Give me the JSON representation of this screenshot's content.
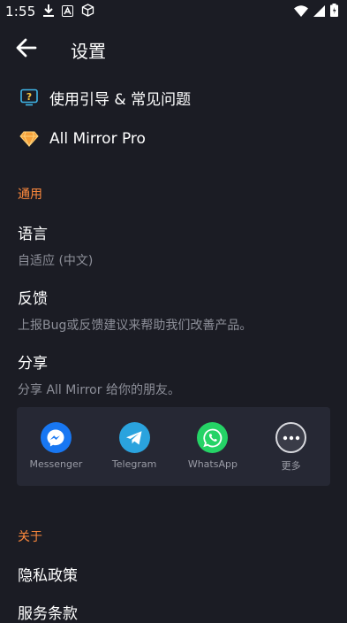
{
  "status_bar": {
    "time": "1:55"
  },
  "app_bar": {
    "title": "设置"
  },
  "top_items": [
    {
      "label": "使用引导 & 常见问题",
      "icon": "help-icon"
    },
    {
      "label": "All Mirror Pro",
      "icon": "diamond-icon"
    }
  ],
  "sections": {
    "general": "通用",
    "about": "关于"
  },
  "prefs": {
    "language": {
      "title": "语言",
      "summary": "自适应 (中文)"
    },
    "feedback": {
      "title": "反馈",
      "summary": "上报Bug或反馈建议来帮助我们改善产品。"
    },
    "share": {
      "title": "分享",
      "summary": "分享 All Mirror 给你的朋友。"
    }
  },
  "share_apps": [
    {
      "name": "Messenger",
      "icon": "messenger-icon",
      "color": "#1877f2"
    },
    {
      "name": "Telegram",
      "icon": "telegram-icon",
      "color": "#2aa3de"
    },
    {
      "name": "WhatsApp",
      "icon": "whatsapp-icon",
      "color": "#25d366"
    },
    {
      "name": "更多",
      "icon": "more-icon",
      "color": "#3a3c48"
    }
  ],
  "about_items": {
    "privacy": "隐私政策",
    "terms": "服务条款"
  },
  "colors": {
    "accent": "#ff8a3d",
    "background": "#1b1c24",
    "panel": "#262834"
  }
}
